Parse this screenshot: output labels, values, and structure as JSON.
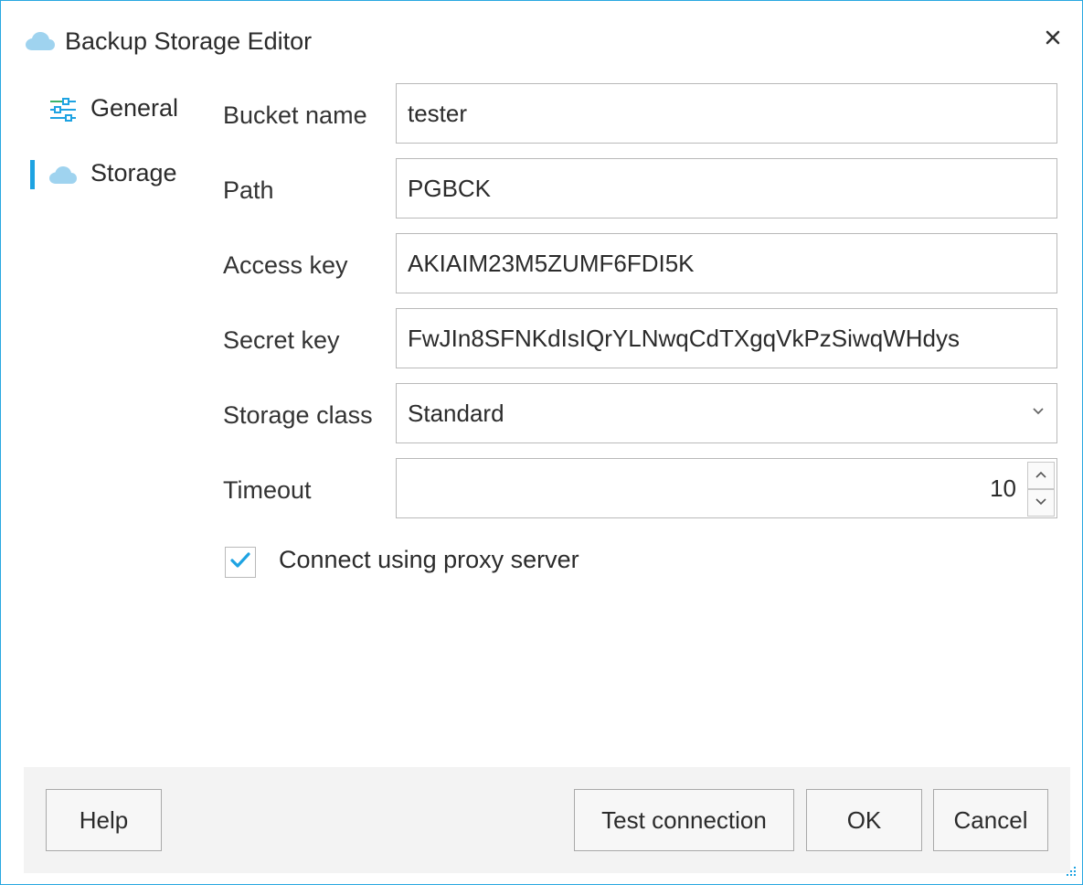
{
  "window": {
    "title": "Backup Storage Editor",
    "accent_color": "#1ea3e2",
    "close_icon": "close-icon",
    "title_icon": "cloud-icon"
  },
  "sidebar": {
    "items": [
      {
        "label": "General",
        "icon": "sliders-icon",
        "selected": false
      },
      {
        "label": "Storage",
        "icon": "cloud-icon",
        "selected": true
      }
    ]
  },
  "form": {
    "bucket_name": {
      "label": "Bucket name",
      "value": "tester"
    },
    "path": {
      "label": "Path",
      "value": "PGBCK"
    },
    "access_key": {
      "label": "Access key",
      "value": "AKIAIM23M5ZUMF6FDI5K"
    },
    "secret_key": {
      "label": "Secret key",
      "value": "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"
    },
    "storage_class": {
      "label": "Storage class",
      "value": "Standard"
    },
    "timeout": {
      "label": "Timeout",
      "value": "10"
    },
    "proxy": {
      "label": "Connect using proxy server",
      "checked": true
    }
  },
  "footer": {
    "help_label": "Help",
    "test_label": "Test connection",
    "ok_label": "OK",
    "cancel_label": "Cancel"
  }
}
